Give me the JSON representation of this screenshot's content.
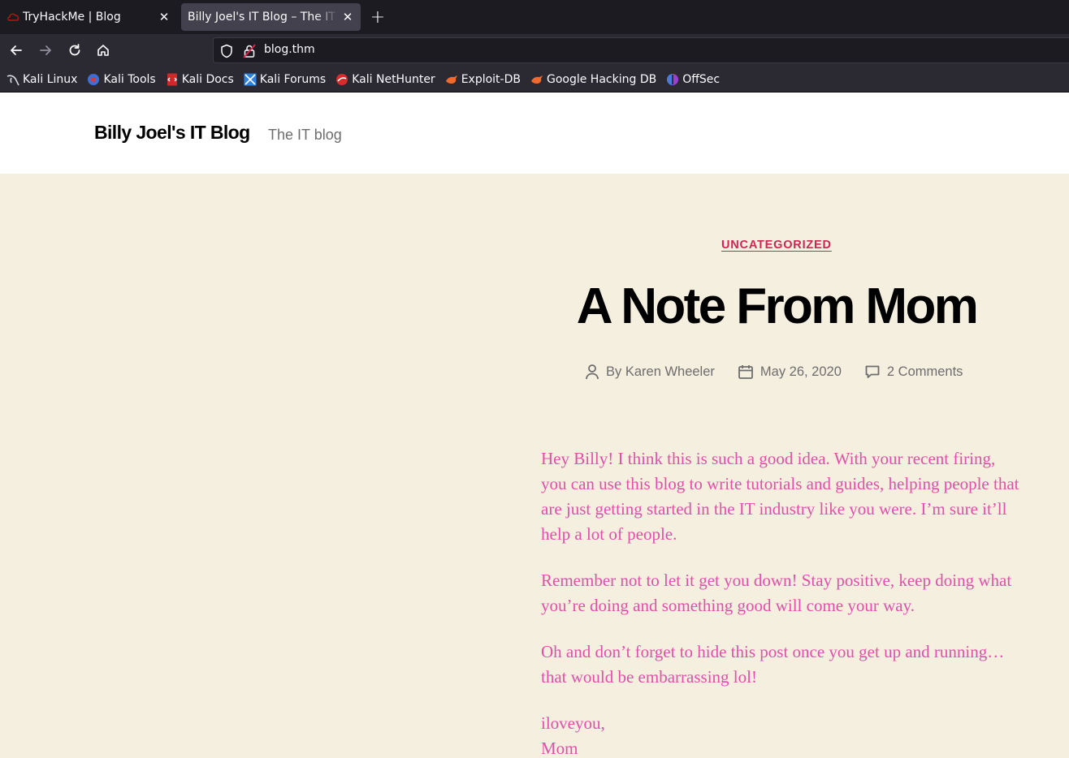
{
  "browser": {
    "tabs": [
      {
        "title": "TryHackMe | Blog",
        "active": false,
        "icon": "tryhackme-icon"
      },
      {
        "title": "Billy Joel's IT Blog – The IT blog",
        "active": true,
        "icon": null
      }
    ],
    "address": {
      "url": "blog.thm"
    },
    "bookmarks": [
      {
        "label": "Kali Linux",
        "icon": "kali-linux-icon"
      },
      {
        "label": "Kali Tools",
        "icon": "kali-tools-icon"
      },
      {
        "label": "Kali Docs",
        "icon": "kali-docs-icon"
      },
      {
        "label": "Kali Forums",
        "icon": "kali-forums-icon"
      },
      {
        "label": "Kali NetHunter",
        "icon": "kali-nethunter-icon"
      },
      {
        "label": "Exploit-DB",
        "icon": "exploit-db-icon"
      },
      {
        "label": "Google Hacking DB",
        "icon": "google-hacking-db-icon"
      },
      {
        "label": "OffSec",
        "icon": "offsec-icon"
      }
    ]
  },
  "site": {
    "title": "Billy Joel's IT Blog",
    "description": "The IT blog"
  },
  "post": {
    "category": "UNCATEGORIZED",
    "title": "A Note From Mom",
    "author": "By Karen Wheeler",
    "date": "May 26, 2020",
    "comments": "2 Comments",
    "paragraphs": [
      "Hey Billy!  I think this is such a good idea.  With your recent firing, you can use this blog to write tutorials and guides, helping people that are just getting started in the IT industry like you were.  I’m sure it’ll help a lot of people.",
      "Remember not to let it get you down!  Stay positive, keep doing what you’re doing and something good will come your way.",
      "Oh and don’t forget to hide this post once you get up and running… that would be embarrassing lol!"
    ],
    "signoff_1": "iloveyou,",
    "signoff_2": "Mom"
  },
  "colors": {
    "accent": "#cd2653",
    "body_text": "#e34fa8",
    "page_bg": "#f5efe0",
    "meta_text": "#6d6d6d"
  }
}
